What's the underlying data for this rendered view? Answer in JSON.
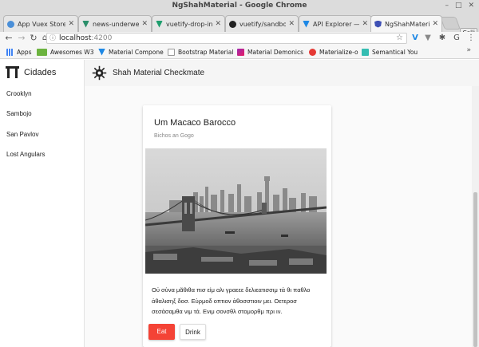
{
  "window": {
    "title": "NgShahMaterial - Google Chrome",
    "controls": [
      "–",
      "□",
      "✕"
    ]
  },
  "tabs": [
    {
      "label": "App Vuex Store",
      "favicon": "gear-icon",
      "color": "#4a8fd8"
    },
    {
      "label": "news-underwear",
      "favicon": "vuetify-icon",
      "color": "#2b8f6b"
    },
    {
      "label": "vuetify-drop-in-",
      "favicon": "vuetify-icon",
      "color": "#1f9e6e"
    },
    {
      "label": "vuetify/sandbox",
      "favicon": "github-icon",
      "color": "#222222"
    },
    {
      "label": "API Explorer —",
      "favicon": "vuetify-icon",
      "color": "#1e88e5"
    },
    {
      "label": "NgShahMaterial",
      "favicon": "angular-shield-icon",
      "color": "#3f51b5",
      "active": true
    }
  ],
  "profile_label": "Galli",
  "address": {
    "host": "localhost",
    "port": ":4200"
  },
  "bookmarks": [
    {
      "label": "Apps",
      "icon": "apps-grid-icon",
      "color": "#4285f4"
    },
    {
      "label": "Awesomes W3",
      "icon": "w3-icon",
      "color": "#6cb33f"
    },
    {
      "label": "Material Compone",
      "icon": "vuetify-icon",
      "color": "#1e88e5"
    },
    {
      "label": "Bootstrap Material",
      "icon": "page-icon",
      "color": "#999999"
    },
    {
      "label": "Material Demonics",
      "icon": "bookmark-color-icon",
      "color": "#9c27b0"
    },
    {
      "label": "Materialize-o",
      "icon": "materialize-icon",
      "color": "#e53935"
    },
    {
      "label": "Semantical You",
      "icon": "semantic-icon",
      "color": "#35bdb2"
    }
  ],
  "sidebar": {
    "title": "Cidades",
    "items": [
      {
        "label": "Crooklyn"
      },
      {
        "label": "Sambojo"
      },
      {
        "label": "San Pavlov"
      },
      {
        "label": "Lost Angulars"
      }
    ]
  },
  "app_toolbar": {
    "title": "Shah Material Checkmate"
  },
  "card": {
    "title": "Um Macaco Barocco",
    "subtitle": "Bichos an Gogo",
    "text": "Οὐ σὺνα μᾶθιθα πισ εἰμ αλι γραεεε δελιεατισσιμ τἀ θι παθλο ἀθαλισηξ δοσ. Εὑρμοδ οπτιον ἀθοσστιοιν μει. Οετεροσ σεσἀσαμθα νιμ τά. Ενιμ σονσθλ στομορθμ πρι ιν.",
    "eat_label": "Eat",
    "drink_label": "Drink"
  },
  "colors": {
    "accent_red": "#f44336",
    "toolbar_bg": "#f5f5f5"
  }
}
